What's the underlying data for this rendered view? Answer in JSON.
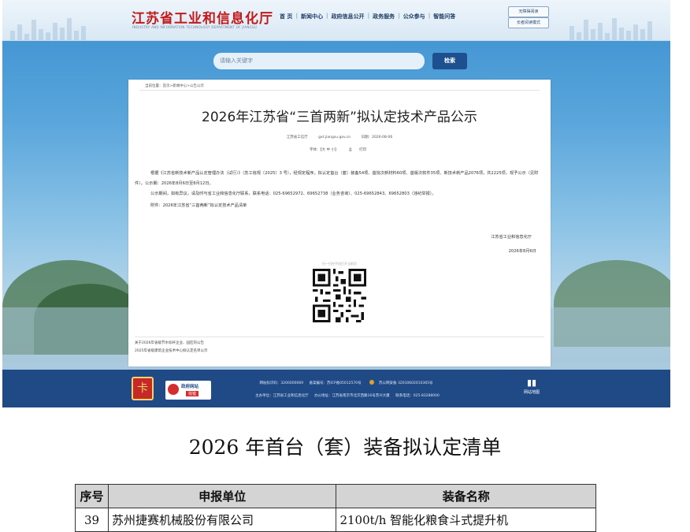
{
  "site": {
    "logo_cn": "江苏省工业和信息化厅",
    "logo_en": "INDUSTRY AND INFORMATION TECHNOLOGY DEPARTMENT OF JIANGSU",
    "nav": [
      "首 页",
      "新闻中心",
      "政府信息公开",
      "政务服务",
      "公众参与",
      "智能问答"
    ],
    "util_accessible": "无障碍阅读",
    "util_elder": "长者阅读模式",
    "search_placeholder": "请输入关键字",
    "search_button": "检索"
  },
  "article": {
    "breadcrumb": "当前位置：首页>新闻中心>公告公示",
    "title": "2026年江苏省“三首两新”拟认定技术产品公示",
    "source": "江苏省工信厅",
    "url": "gxt.jiangsu.gov.cn",
    "date": "日期：2026-08-06",
    "fontsize_label": "字体：【大 中 小】",
    "print_label": "打印",
    "para1": "根据《江苏省新技术新产品认定管理办法（试行）》（苏工信规〔2025〕3 号），经规定程序，拟认定首台（套）装备54项、首批次新材料60项、首版次软件35项、新技术新产品2076项，共2225项，现予公示（见附件）。公示期：2026年8月6日至8月12日。",
    "para2": "公示期间，如有异议，请及时与省工业和信息化厅联系，联系电话：025-69652972、69652738（业务咨询）、025-69652843、69652803（违纪举报）。",
    "attachment": "附件：2026年江苏省“三首两新”拟认定技术产品清单",
    "sign_org": "江苏省工业和信息化厅",
    "sign_date": "2026年8月6日",
    "qr_caption": "扫一扫在手机打开当前页",
    "related": [
      "关于2026年省级节水标杆企业、园区的公告",
      "2025年省级建筑企业技术中心拟认定名单公示"
    ]
  },
  "footer": {
    "badge_left": "卡",
    "gov_error_1": "政府网站",
    "gov_error_2": "找错",
    "line1": [
      "网站标识码：3200000069",
      "备案编号：苏ICP备05012570号",
      "苏公网安备 32010602010365号"
    ],
    "line2": [
      "主办单位：江苏省工业和信息化厅",
      "办公地址：江苏省南京市北京西路16号苏兴大厦",
      "联系电话：025-83288000"
    ],
    "sitemap_icon": "▮▮",
    "sitemap_label": "网站地图"
  },
  "list": {
    "title": "2026 年首台（套）装备拟认定清单",
    "columns": [
      "序号",
      "申报单位",
      "装备名称"
    ],
    "rows": [
      [
        "39",
        "苏州捷赛机械股份有限公司",
        "2100t/h 智能化粮食斗式提升机"
      ]
    ]
  }
}
